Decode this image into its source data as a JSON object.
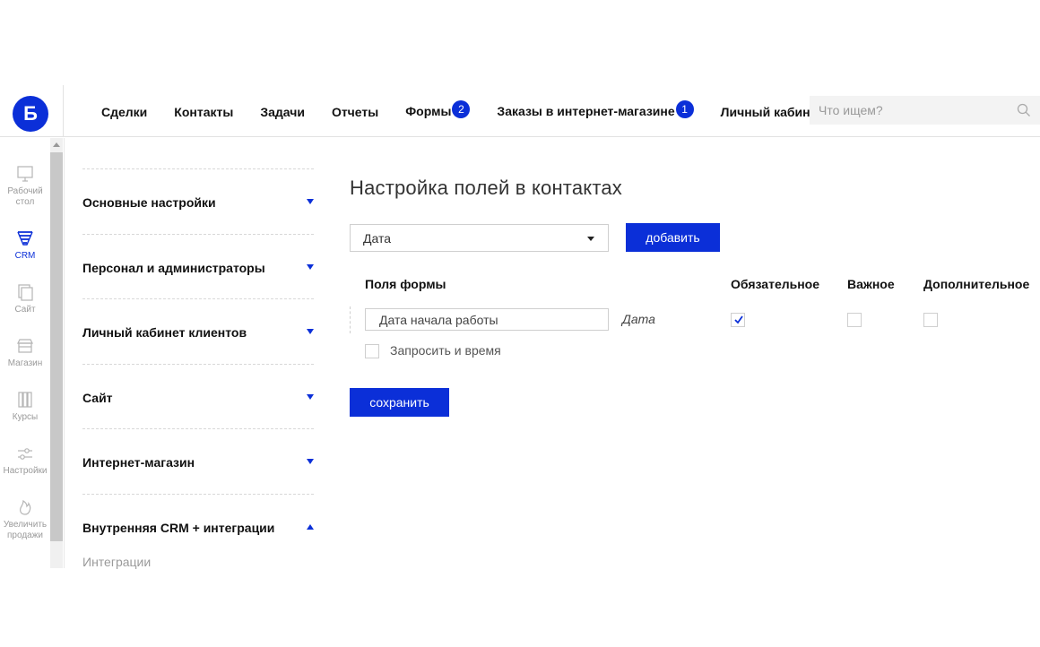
{
  "header": {
    "logo_text": "Б",
    "nav": [
      {
        "label": "Сделки"
      },
      {
        "label": "Контакты"
      },
      {
        "label": "Задачи"
      },
      {
        "label": "Отчеты"
      },
      {
        "label": "Формы",
        "badge": "2"
      },
      {
        "label": "Заказы в интернет-магазине",
        "badge": "1"
      },
      {
        "label": "Личный кабинет"
      }
    ],
    "search_placeholder": "Что ищем?"
  },
  "rail": {
    "items": [
      {
        "label_line1": "Рабочий",
        "label_line2": "стол",
        "icon": "monitor-icon"
      },
      {
        "label_line1": "CRM",
        "label_line2": "",
        "icon": "funnel-icon"
      },
      {
        "label_line1": "Сайт",
        "label_line2": "",
        "icon": "pages-icon"
      },
      {
        "label_line1": "Магазин",
        "label_line2": "",
        "icon": "store-icon"
      },
      {
        "label_line1": "Курсы",
        "label_line2": "",
        "icon": "books-icon"
      },
      {
        "label_line1": "Настройки",
        "label_line2": "",
        "icon": "sliders-icon"
      },
      {
        "label_line1": "Увеличить",
        "label_line2": "продажи",
        "icon": "flame-icon"
      }
    ]
  },
  "menu": {
    "sections": [
      {
        "label": "Основные настройки"
      },
      {
        "label": "Персонал и администраторы"
      },
      {
        "label": "Личный кабинет клиентов"
      },
      {
        "label": "Сайт"
      },
      {
        "label": "Интернет-магазин"
      },
      {
        "label": "Внутренняя CRM + интеграции"
      }
    ],
    "sub_item": "Интеграции"
  },
  "main": {
    "title": "Настройка полей в контактах",
    "select_value": "Дата",
    "add_button": "добавить",
    "columns": {
      "fields": "Поля формы",
      "required": "Обязательное",
      "important": "Важное",
      "additional": "Дополнительное"
    },
    "row": {
      "field_value": "Дата начала работы",
      "field_type": "Дата",
      "required": true,
      "important": false,
      "additional": false
    },
    "request_time_label": "Запросить и время",
    "request_time_checked": false,
    "save_button": "сохранить"
  },
  "colors": {
    "accent": "#0b2fd8",
    "muted_text": "#9a9a9a"
  }
}
